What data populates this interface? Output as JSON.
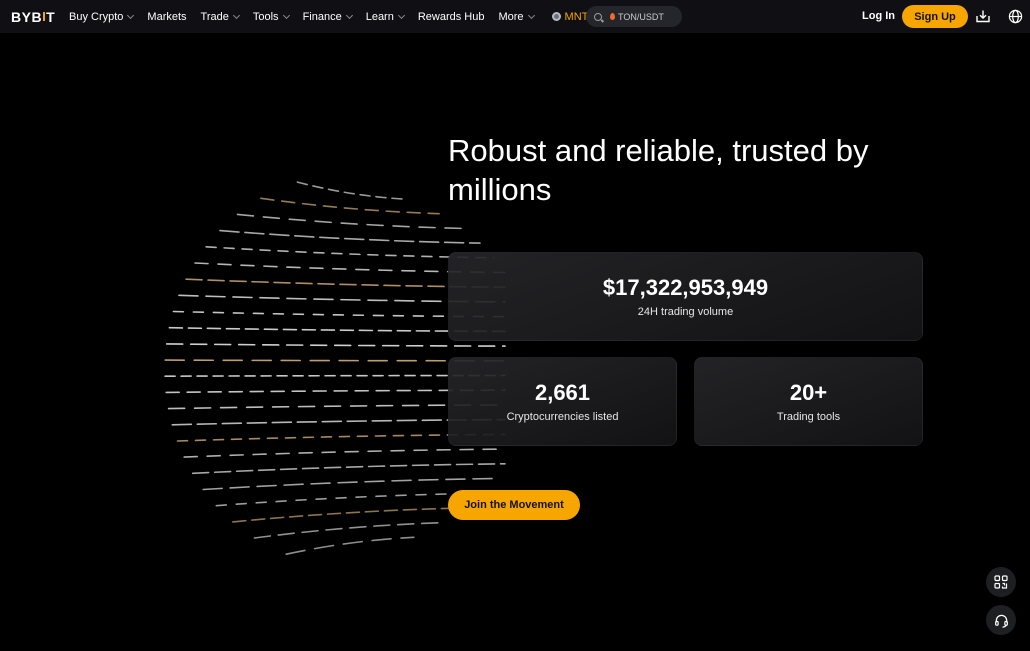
{
  "nav": {
    "logo": "BYB",
    "logo_end": "T",
    "items": [
      {
        "label": "Buy Crypto",
        "dropdown": true
      },
      {
        "label": "Markets",
        "dropdown": false
      },
      {
        "label": "Trade",
        "dropdown": true
      },
      {
        "label": "Tools",
        "dropdown": true
      },
      {
        "label": "Finance",
        "dropdown": true
      },
      {
        "label": "Learn",
        "dropdown": true
      },
      {
        "label": "Rewards Hub",
        "dropdown": false
      },
      {
        "label": "More",
        "dropdown": true
      }
    ],
    "mnt": "MNT",
    "search": {
      "value": "TON/USDT"
    },
    "login": "Log In",
    "signup": "Sign Up"
  },
  "hero": {
    "headline": "Robust and reliable, trusted by millions",
    "stats": [
      {
        "value": "$17,322,953,949",
        "label": "24H trading volume"
      },
      {
        "value": "2,661",
        "label": "Cryptocurrencies listed"
      },
      {
        "value": "20+",
        "label": "Trading tools"
      }
    ],
    "cta": "Join the Movement"
  },
  "colors": {
    "accent": "#f7a600",
    "background": "#000000",
    "nav_bg": "#101014"
  },
  "icons": {
    "download": "download-icon",
    "language": "globe-icon",
    "qr": "qr-code-icon",
    "support": "headset-icon"
  }
}
